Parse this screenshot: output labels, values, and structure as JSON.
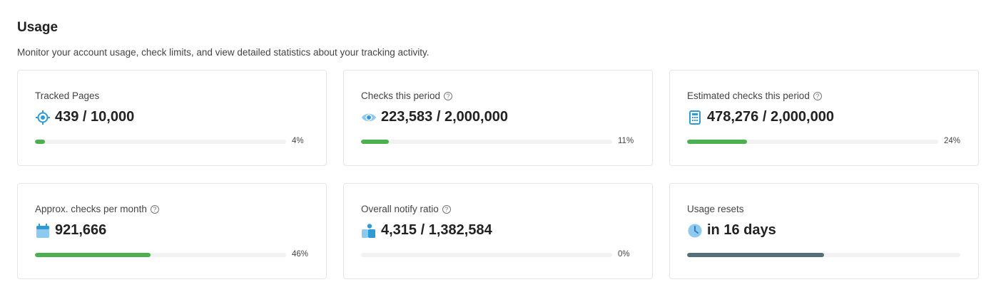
{
  "page": {
    "title": "Usage",
    "subtitle": "Monitor your account usage, check limits, and view detailed statistics about your tracking activity."
  },
  "cards": [
    {
      "label": "Tracked Pages",
      "value": "439 / 10,000",
      "percent_label": "4%",
      "progress": 0.04,
      "icon": "target-icon",
      "help": false
    },
    {
      "label": "Checks this period",
      "value": "223,583 / 2,000,000",
      "percent_label": "11%",
      "progress": 0.11,
      "icon": "eye-icon",
      "help": true
    },
    {
      "label": "Estimated checks this period",
      "value": "478,276 / 2,000,000",
      "percent_label": "24%",
      "progress": 0.24,
      "icon": "calculator-icon",
      "help": true
    },
    {
      "label": "Approx. checks per month",
      "value": "921,666",
      "percent_label": "46%",
      "progress": 0.46,
      "icon": "calendar-icon",
      "help": true
    },
    {
      "label": "Overall notify ratio",
      "value": "4,315 / 1,382,584",
      "percent_label": "0%",
      "progress": 0.0,
      "icon": "notify-person-icon",
      "help": true
    },
    {
      "label": "Usage resets",
      "value": "in 16 days",
      "percent_label": "",
      "progress": 0.5,
      "icon": "clock-icon",
      "help": false
    }
  ],
  "help_glyph": "?",
  "colors": {
    "progress_fill": "#4caf50",
    "reset_fill": "#546e7a",
    "track": "#f2f2f2",
    "icon_blue": "#2f9bd6"
  }
}
